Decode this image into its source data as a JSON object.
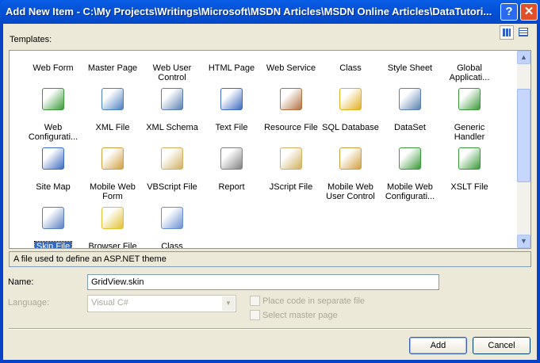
{
  "window": {
    "title": "Add New Item - C:\\My Projects\\Writings\\Microsoft\\MSDN Articles\\MSDN Online Articles\\DataTutori...",
    "help": "?",
    "close": "✕"
  },
  "templates_label": "Templates:",
  "templates": [
    {
      "label": "Web Form",
      "color": "#6a8fd0"
    },
    {
      "label": "Master Page",
      "color": "#6a8fd0"
    },
    {
      "label": "Web User Control",
      "color": "#6a8fd0"
    },
    {
      "label": "HTML Page",
      "color": "#6a8fd0"
    },
    {
      "label": "Web Service",
      "color": "#6a8fd0"
    },
    {
      "label": "Class",
      "color": "#6a8fd0"
    },
    {
      "label": "Style Sheet",
      "color": "#6a8fd0"
    },
    {
      "label": "Global Applicati...",
      "color": "#6a8fd0"
    },
    {
      "label": "Web Configurati...",
      "color": "#3a9a3a"
    },
    {
      "label": "XML File",
      "color": "#4a7fc0"
    },
    {
      "label": "XML Schema",
      "color": "#5a80b0"
    },
    {
      "label": "Text File",
      "color": "#3d6bc0"
    },
    {
      "label": "Resource File",
      "color": "#b07040"
    },
    {
      "label": "SQL Database",
      "color": "#e0b020"
    },
    {
      "label": "DataSet",
      "color": "#5a80b0"
    },
    {
      "label": "Generic Handler",
      "color": "#3a9a3a"
    },
    {
      "label": "Site Map",
      "color": "#3d6bc0"
    },
    {
      "label": "Mobile Web Form",
      "color": "#d0a040"
    },
    {
      "label": "VBScript File",
      "color": "#d0b060"
    },
    {
      "label": "Report",
      "color": "#808080"
    },
    {
      "label": "JScript File",
      "color": "#d0b060"
    },
    {
      "label": "Mobile Web User Control",
      "color": "#d0a040"
    },
    {
      "label": "Mobile Web Configurati...",
      "color": "#3a9a3a"
    },
    {
      "label": "XSLT File",
      "color": "#3a9a3a"
    },
    {
      "label": "Skin File",
      "color": "#5a7fc0",
      "selected": true
    },
    {
      "label": "Browser File",
      "color": "#e0c030"
    },
    {
      "label": "Class Diagram",
      "color": "#6a8fd0"
    }
  ],
  "description": "A file used to define an ASP.NET theme",
  "name": {
    "label": "Name:",
    "value": "GridView.skin"
  },
  "language": {
    "label": "Language:",
    "value": "Visual C#"
  },
  "options": {
    "separate_code": "Place code in separate file",
    "master_page": "Select master page"
  },
  "buttons": {
    "add": "Add",
    "cancel": "Cancel"
  }
}
